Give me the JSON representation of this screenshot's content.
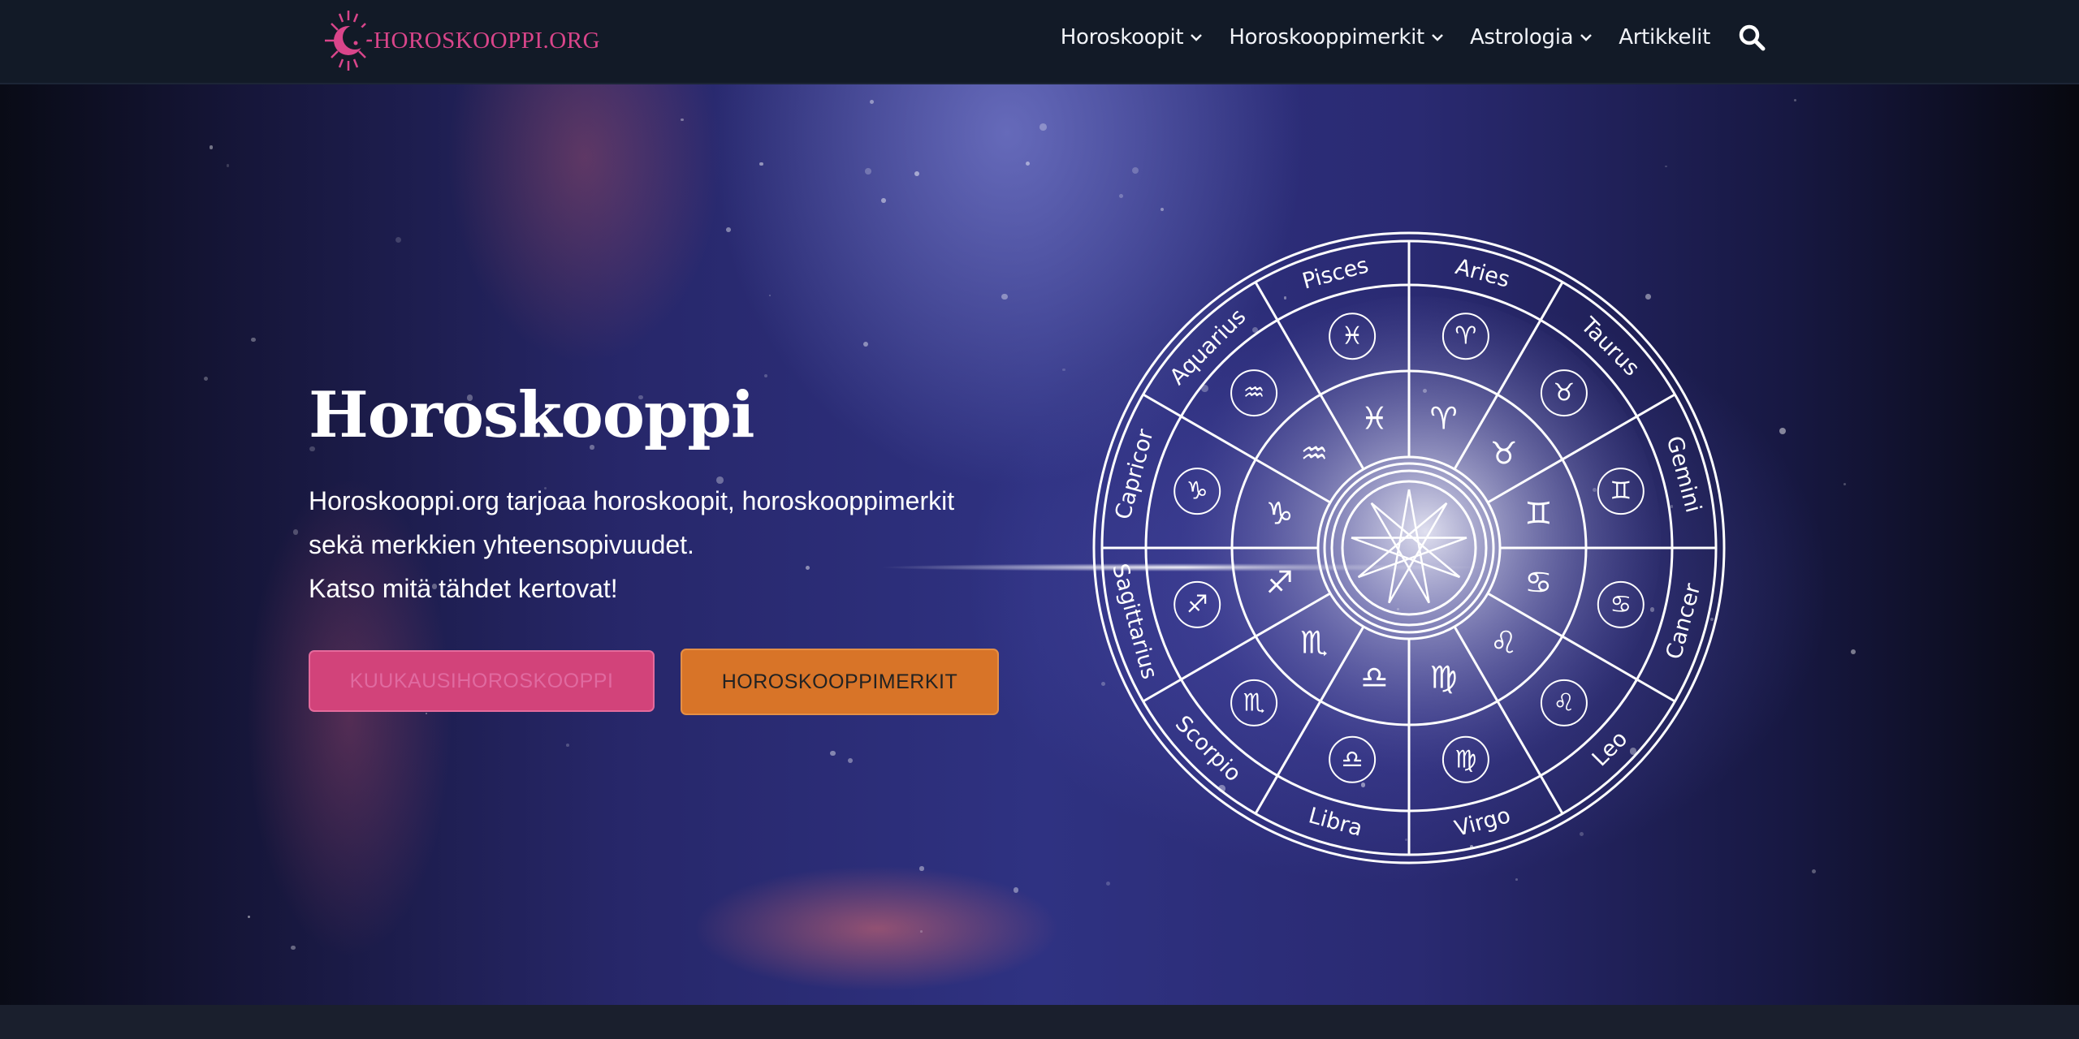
{
  "header": {
    "logo_text": "HOROSKOOPPI.ORG",
    "nav": [
      {
        "label": "Horoskoopit",
        "has_dropdown": true
      },
      {
        "label": "Horoskooppimerkit",
        "has_dropdown": true
      },
      {
        "label": "Astrologia",
        "has_dropdown": true
      },
      {
        "label": "Artikkelit",
        "has_dropdown": false
      }
    ],
    "search_icon": "search-icon"
  },
  "hero": {
    "title": "Horoskooppi",
    "lines": [
      "Horoskooppi.org tarjoaa horoskoopit, horoskooppimerkit",
      "sekä merkkien yhteensopivuudet.",
      "Katso mitä tähdet kertovat!"
    ],
    "buttons": {
      "primary": "KUUKAUSIHOROSKOOPPI",
      "secondary": "HOROSKOOPPIMERKIT"
    }
  },
  "zodiac_wheel": {
    "signs": [
      "Aries",
      "Taurus",
      "Gemini",
      "Cancer",
      "Leo",
      "Virgo",
      "Libra",
      "Scorpio",
      "Sagittarius",
      "Capricor",
      "Aquarius",
      "Pisces"
    ],
    "symbols": [
      "♈",
      "♉",
      "♊",
      "♋",
      "♌",
      "♍",
      "♎",
      "♏",
      "♐",
      "♑",
      "♒",
      "♓"
    ]
  },
  "colors": {
    "header_bg": "#121a27",
    "brand_pink": "#d9458a",
    "button_pink": "#d2437a",
    "button_orange": "#d87428"
  }
}
